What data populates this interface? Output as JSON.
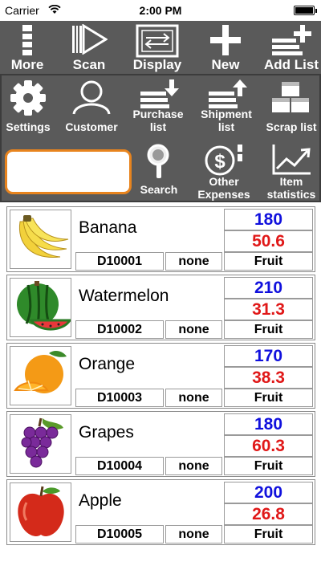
{
  "status": {
    "carrier": "Carrier",
    "time": "2:00 PM"
  },
  "toolbar": {
    "more": "More",
    "scan": "Scan",
    "display": "Display",
    "new": "New",
    "add_list": "Add List"
  },
  "panel": {
    "settings": "Settings",
    "customer": "Customer",
    "purchase_l1": "Purchase",
    "purchase_l2": "list",
    "shipment_l1": "Shipment",
    "shipment_l2": "list",
    "scrap": "Scrap list",
    "search_value": "",
    "search": "Search",
    "other_l1": "Other",
    "other_l2": "Expenses",
    "item_l1": "Item",
    "item_l2": "statistics"
  },
  "items": [
    {
      "name": "Banana",
      "qty": "180",
      "price": "50.6",
      "code": "D10001",
      "tag": "none",
      "category": "Fruit"
    },
    {
      "name": "Watermelon",
      "qty": "210",
      "price": "31.3",
      "code": "D10002",
      "tag": "none",
      "category": "Fruit"
    },
    {
      "name": "Orange",
      "qty": "170",
      "price": "38.3",
      "code": "D10003",
      "tag": "none",
      "category": "Fruit"
    },
    {
      "name": "Grapes",
      "qty": "180",
      "price": "60.3",
      "code": "D10004",
      "tag": "none",
      "category": "Fruit"
    },
    {
      "name": "Apple",
      "qty": "200",
      "price": "26.8",
      "code": "D10005",
      "tag": "none",
      "category": "Fruit"
    }
  ],
  "colors": {
    "toolbar_bg": "#5a5a5a",
    "search_border": "#e8841e",
    "qty": "#1010dd",
    "price": "#e01818"
  }
}
